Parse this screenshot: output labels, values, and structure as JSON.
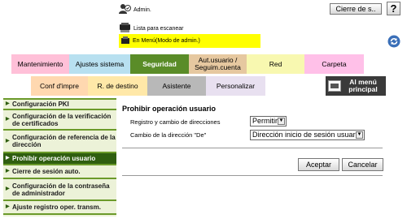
{
  "header": {
    "user_label": "Admin.",
    "status_label": "Lista para escanear",
    "mode_label": "En Menú(Modo de admin.)",
    "logout_label": "Cierre de s..",
    "help_label": "?"
  },
  "tabs_row1": [
    {
      "label": "Mantenimiento",
      "color": "#ffc0d8"
    },
    {
      "label": "Ajustes sistema",
      "color": "#b8e0f0"
    },
    {
      "label": "Seguridad",
      "color": "#5a8c28",
      "selected": true
    },
    {
      "label": "Aut.usuario / Seguim.cuenta",
      "color": "#e6c8a0"
    },
    {
      "label": "Red",
      "color": "#f8f8b0"
    },
    {
      "label": "Carpeta",
      "color": "#ffc0e8"
    }
  ],
  "tabs_row2": [
    {
      "label": "Conf d'impre",
      "color": "#ffd8b0"
    },
    {
      "label": "R. de destino",
      "color": "#ffe8a8"
    },
    {
      "label": "Asistente",
      "color": "#b8b8b8"
    },
    {
      "label": "Personalizar",
      "color": "#e8e0f0"
    },
    {
      "label": "Al menú principal",
      "color": "#3a3a3a"
    }
  ],
  "sidebar": {
    "items": [
      {
        "label": "Configuración PKI"
      },
      {
        "label": "Configuración de la verificación de certificados"
      },
      {
        "label": "Configuración de referencia de la dirección"
      },
      {
        "label": "Prohibir operación usuario",
        "active": true
      },
      {
        "label": "Cierre de sesión auto."
      },
      {
        "label": "Configuración de la contraseña de administrador"
      },
      {
        "label": "Ajuste registro oper. transm."
      }
    ]
  },
  "main": {
    "title": "Prohibir operación usuario",
    "fields": [
      {
        "label": "Registro y cambio de direcciones",
        "value": "Permitir"
      },
      {
        "label": "Cambio de la dirección \"De\"",
        "value": "Dirección inicio de sesión usuario"
      }
    ],
    "ok_label": "Aceptar",
    "cancel_label": "Cancelar"
  }
}
